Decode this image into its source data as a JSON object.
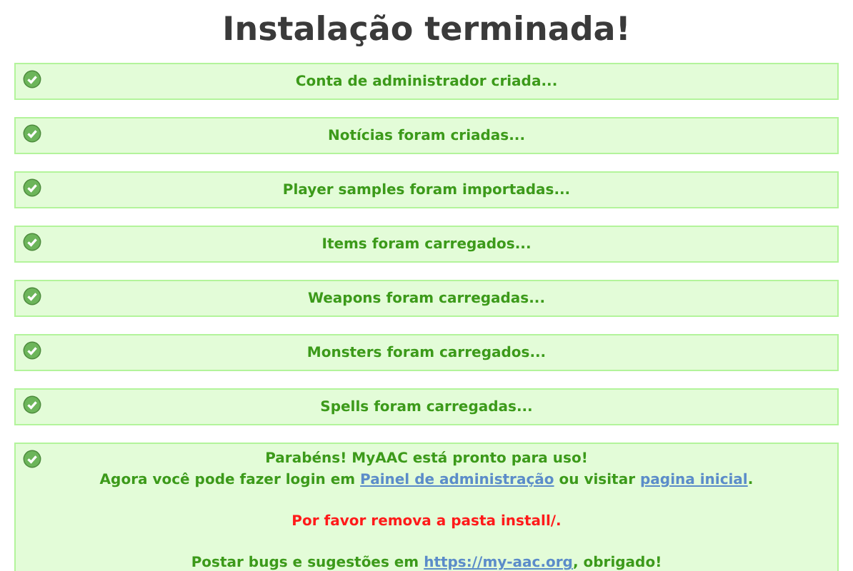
{
  "title": "Instalação terminada!",
  "steps": [
    {
      "label": "Conta de administrador criada..."
    },
    {
      "label": "Notícias foram criadas..."
    },
    {
      "label": "Player samples foram importadas..."
    },
    {
      "label": "Items foram carregados..."
    },
    {
      "label": "Weapons foram carregadas..."
    },
    {
      "label": "Monsters foram carregados..."
    },
    {
      "label": "Spells foram carregadas..."
    }
  ],
  "final": {
    "lines": [
      {
        "kind": "text",
        "parts": [
          {
            "kind": "text",
            "text": "Parabéns! MyAAC está pronto para uso!"
          }
        ]
      },
      {
        "kind": "text",
        "parts": [
          {
            "kind": "text",
            "text": "Agora você pode fazer login em "
          },
          {
            "kind": "link",
            "text": "Painel de administração"
          },
          {
            "kind": "text",
            "text": " ou visitar "
          },
          {
            "kind": "link",
            "text": "pagina inicial"
          },
          {
            "kind": "text",
            "text": "."
          }
        ]
      },
      {
        "kind": "warning",
        "parts": [
          {
            "kind": "text",
            "text": "Por favor remova a pasta install/."
          }
        ]
      },
      {
        "kind": "text",
        "parts": [
          {
            "kind": "text",
            "text": "Postar bugs e sugestões em "
          },
          {
            "kind": "link",
            "text": "https://my-aac.org"
          },
          {
            "kind": "text",
            "text": ", obrigado!"
          }
        ]
      }
    ]
  }
}
